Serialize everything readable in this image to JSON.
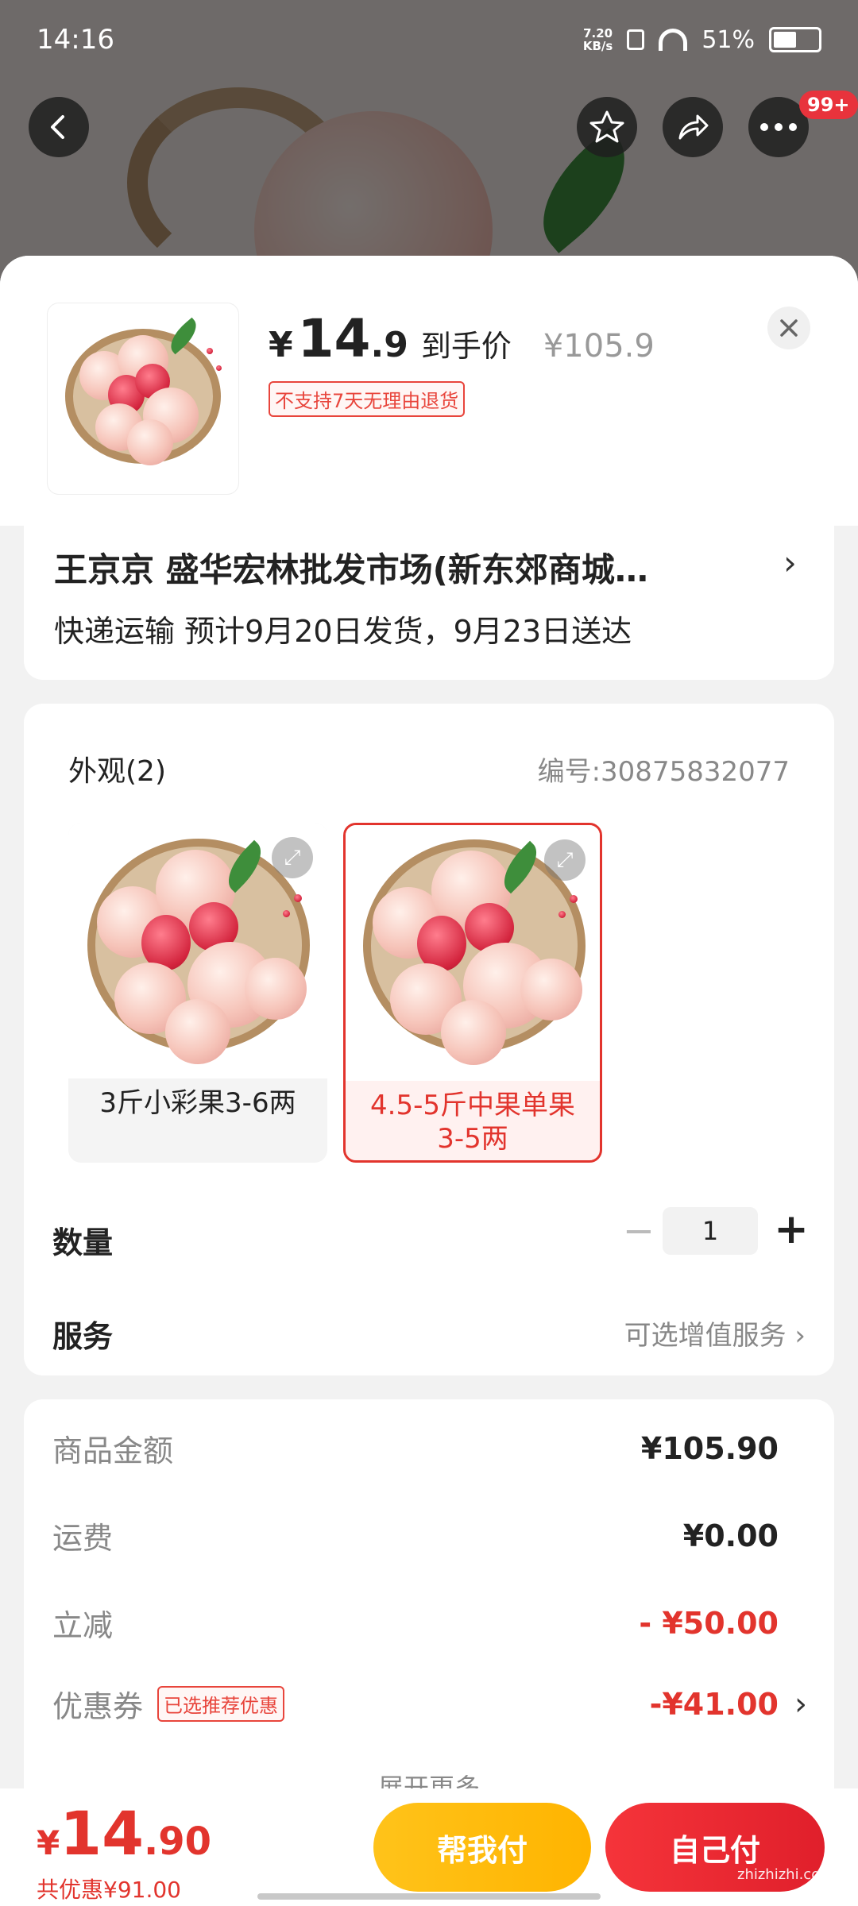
{
  "status_bar": {
    "time": "14:16",
    "net_speed_top": "7.20",
    "net_speed_bottom": "KB/s",
    "battery": "51%",
    "battery_level": 0.51
  },
  "top_nav": {
    "back_icon": "back-arrow-icon",
    "favorite_icon": "star-icon",
    "share_icon": "share-icon",
    "more_icon": "more-icon",
    "more_badge": "99+"
  },
  "product": {
    "price_symbol": "¥",
    "price_int": "14",
    "price_dec": ".9",
    "price_label": "到手价",
    "original_price": "¥105.9",
    "return_policy": "不支持7天无理由退货"
  },
  "address": {
    "line": "王京京  盛华宏林批发市场(新东郊商城…",
    "shipping": "快递运输 预计9月20日发货，9月23日送达"
  },
  "spec": {
    "title": "外观(2)",
    "code": "编号:30875832077",
    "options": [
      {
        "label": "3斤小彩果3-6两",
        "selected": false
      },
      {
        "label": "4.5-5斤中果单果3-5两",
        "selected": true
      }
    ]
  },
  "quantity": {
    "label": "数量",
    "value": "1",
    "minus": "−",
    "plus": "+"
  },
  "service": {
    "label": "服务",
    "value": "可选增值服务 ›"
  },
  "summary": {
    "rows": [
      {
        "label": "商品金额",
        "value": "¥105.90"
      },
      {
        "label": "运费",
        "value": "¥0.00"
      },
      {
        "label": "立减",
        "value": "- ¥50.00"
      },
      {
        "label": "优惠券",
        "tag": "已选推荐优惠",
        "value": "-¥41.00"
      }
    ],
    "more_hint": "展开更多"
  },
  "bottom_bar": {
    "total_symbol": "¥",
    "total_int": "14",
    "total_dec": ".90",
    "total_save": "共优惠¥91.00",
    "help_pay": "帮我付",
    "self_pay": "自己付"
  },
  "watermark": "zhizhizhi.com",
  "colors": {
    "accent_red": "#e2342d",
    "help_yellow": "#ffb400"
  }
}
